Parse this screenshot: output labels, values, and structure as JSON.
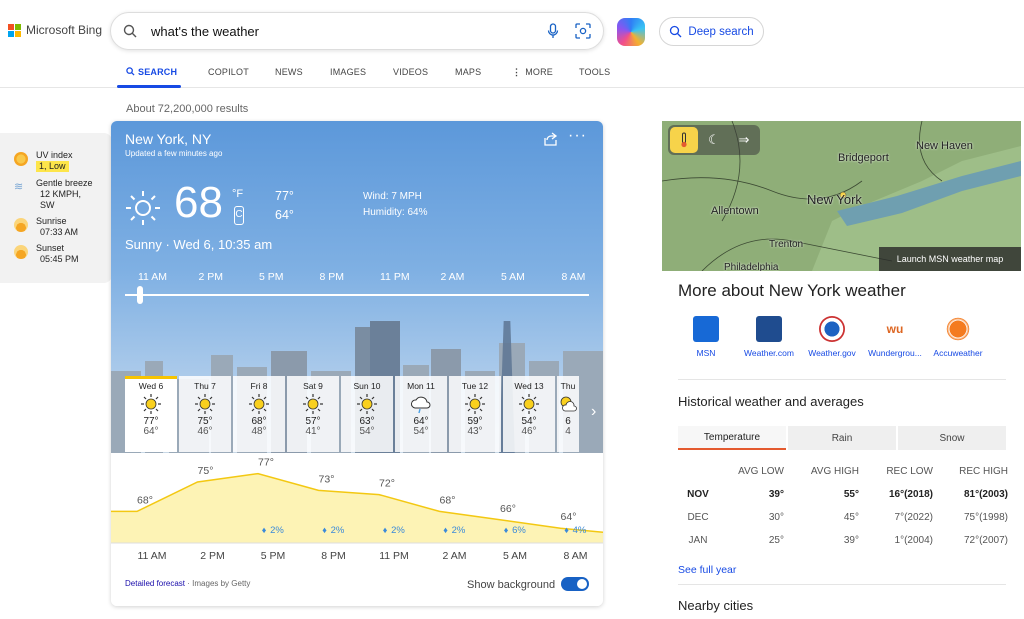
{
  "header": {
    "brand": "Microsoft Bing",
    "query": "what's the weather",
    "deep_search_label": "Deep search"
  },
  "nav": {
    "search": "SEARCH",
    "copilot": "COPILOT",
    "news": "NEWS",
    "images": "IMAGES",
    "videos": "VIDEOS",
    "maps": "MAPS",
    "more": "MORE",
    "tools": "TOOLS"
  },
  "results_count": "About 72,200,000 results",
  "sidepanel": {
    "uv_label": "UV index",
    "uv_value": "1, Low",
    "wind_label": "Gentle breeze",
    "wind_value": "12 KMPH, SW",
    "sunrise_label": "Sunrise",
    "sunrise_value": "07:33 AM",
    "sunset_label": "Sunset",
    "sunset_value": "05:45 PM"
  },
  "weather": {
    "location": "New York, NY",
    "updated": "Updated a few minutes ago",
    "temp": "68",
    "unit_f": "°F",
    "unit_c": "C",
    "high": "77°",
    "low": "64°",
    "wind": "Wind: 7 MPH",
    "humidity": "Humidity: 64%",
    "condition": "Sunny · Wed 6, 10:35 am",
    "slider_hours": [
      "11 AM",
      "2 PM",
      "5 PM",
      "8 PM",
      "11 PM",
      "2 AM",
      "5 AM",
      "8 AM"
    ],
    "days": [
      {
        "name": "Wed 6",
        "hi": "77°",
        "lo": "64°",
        "icon": "sun-icon"
      },
      {
        "name": "Thu 7",
        "hi": "75°",
        "lo": "46°",
        "icon": "sun-icon"
      },
      {
        "name": "Fri 8",
        "hi": "68°",
        "lo": "48°",
        "icon": "sun-icon"
      },
      {
        "name": "Sat 9",
        "hi": "57°",
        "lo": "41°",
        "icon": "sun-icon"
      },
      {
        "name": "Sun 10",
        "hi": "63°",
        "lo": "54°",
        "icon": "sun-icon"
      },
      {
        "name": "Mon 11",
        "hi": "64°",
        "lo": "54°",
        "icon": "rain-cloud-icon"
      },
      {
        "name": "Tue 12",
        "hi": "59°",
        "lo": "43°",
        "icon": "sun-icon"
      },
      {
        "name": "Wed 13",
        "hi": "54°",
        "lo": "46°",
        "icon": "sun-icon"
      },
      {
        "name": "Thu",
        "hi": "6",
        "lo": "4",
        "icon": "partly-cloudy-icon"
      }
    ],
    "detailed_forecast": "Detailed forecast",
    "images_credit": "· Images by Getty",
    "show_background": "Show background"
  },
  "chart_data": {
    "type": "area",
    "x": [
      "11 AM",
      "2 PM",
      "5 PM",
      "8 PM",
      "11 PM",
      "2 AM",
      "5 AM",
      "8 AM"
    ],
    "series": [
      {
        "values": [
          68,
          75,
          77,
          73,
          72,
          68,
          66,
          64
        ]
      }
    ],
    "precip": [
      "",
      "",
      "2%",
      "2%",
      "2%",
      "2%",
      "6%",
      "4%"
    ],
    "temp_labels": [
      "68°",
      "75°",
      "77°",
      "73°",
      "72°",
      "68°",
      "66°",
      "64°"
    ]
  },
  "map": {
    "labels": [
      "Bridgeport",
      "New Haven",
      "Allentown",
      "New York",
      "Trenton",
      "Philadelphia"
    ],
    "launch": "Launch MSN weather map"
  },
  "more": {
    "title": "More about New York weather",
    "sources": [
      "MSN",
      "Weather.com",
      "Weather.gov",
      "Wundergrou...",
      "Accuweather"
    ]
  },
  "historical": {
    "title": "Historical weather and averages",
    "tabs": [
      "Temperature",
      "Rain",
      "Snow"
    ],
    "headers": [
      "AVG LOW",
      "AVG HIGH",
      "REC LOW",
      "REC HIGH"
    ],
    "rows": [
      {
        "m": "NOV",
        "c1": "39°",
        "c2": "55°",
        "c3": "16°(2018)",
        "c4": "81°(2003)"
      },
      {
        "m": "DEC",
        "c1": "30°",
        "c2": "45°",
        "c3": "7°(2022)",
        "c4": "75°(1998)"
      },
      {
        "m": "JAN",
        "c1": "25°",
        "c2": "39°",
        "c3": "1°(2004)",
        "c4": "72°(2007)"
      }
    ],
    "see_full": "See full year",
    "nearby": "Nearby cities"
  }
}
